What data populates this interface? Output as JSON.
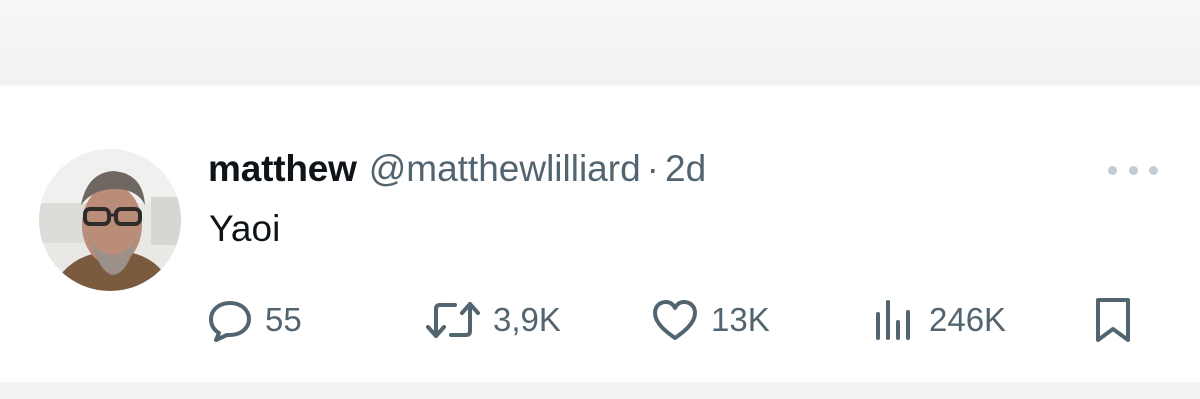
{
  "tweet": {
    "display_name": "matthew",
    "handle": "@matthewlilliard",
    "separator": "·",
    "time": "2d",
    "text": "Yaoi",
    "avatar_icon": "user-photo-avatar"
  },
  "actions": {
    "reply_count": "55",
    "retweet_count": "3,9K",
    "like_count": "13K",
    "views_count": "246K"
  },
  "icons": {
    "reply": "comment-bubble-icon",
    "retweet": "retweet-icon",
    "like": "heart-icon",
    "views": "bar-chart-icon",
    "bookmark": "bookmark-icon",
    "more": "more-dots-icon"
  },
  "colors": {
    "primary_text": "#0f1419",
    "secondary_text": "#536471",
    "more_dots": "#c4ccd3",
    "card_background": "#ffffff"
  }
}
